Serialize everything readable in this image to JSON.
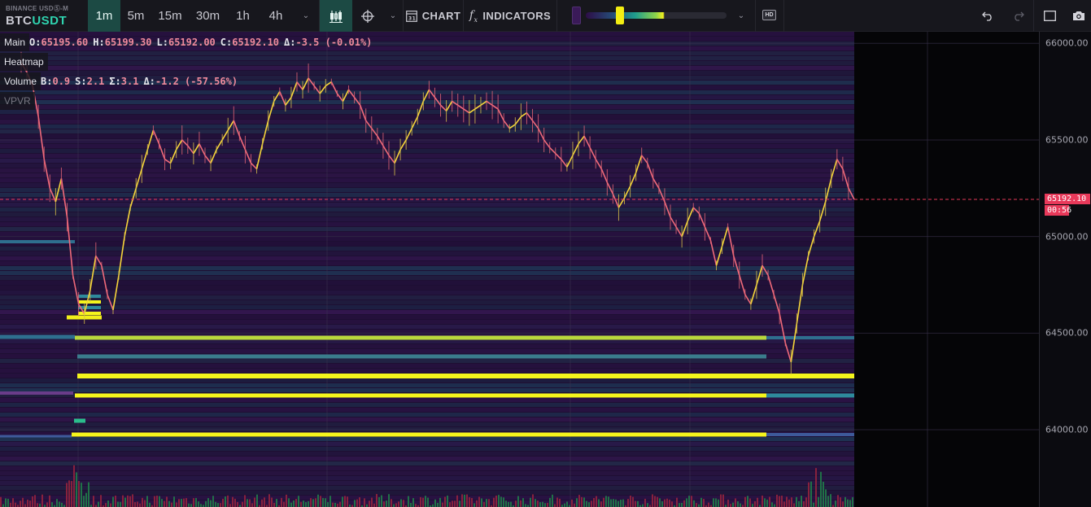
{
  "toolbar": {
    "exchange": "BINANCE USDⓈ-M",
    "symbol_base": "BTC",
    "symbol_quote": "USDT",
    "timeframes": [
      {
        "label": "1m",
        "active": true
      },
      {
        "label": "5m",
        "active": false
      },
      {
        "label": "15m",
        "active": false
      },
      {
        "label": "30m",
        "active": false
      },
      {
        "label": "1h",
        "active": false
      },
      {
        "label": "4h",
        "active": false
      }
    ],
    "chart_label": "CHART",
    "indicators_label": "INDICATORS",
    "hd_label": "HD",
    "colors": {
      "active_bg": "#1c4a44",
      "quote_color": "#2fd4b0"
    }
  },
  "legend": {
    "main": {
      "name": "Main",
      "fields": [
        {
          "k": "O:",
          "v": "65195.60"
        },
        {
          "k": "H:",
          "v": "65199.30"
        },
        {
          "k": "L:",
          "v": "65192.00"
        },
        {
          "k": "C:",
          "v": "65192.10"
        },
        {
          "k": "Δ:",
          "v": "-3.5 (-0.01%)"
        }
      ]
    },
    "heatmap": {
      "name": "Heatmap"
    },
    "volume": {
      "name": "Volume",
      "fields": [
        {
          "k": "B:",
          "v": "0.9"
        },
        {
          "k": "S:",
          "v": "2.1"
        },
        {
          "k": "Σ:",
          "v": "3.1"
        },
        {
          "k": "Δ:",
          "v": "-1.2 (-57.56%)"
        }
      ]
    },
    "vpvr": {
      "name": "VPVR"
    }
  },
  "price_axis": {
    "ticks": [
      "66000.00",
      "65500.00",
      "65000.00",
      "64500.00",
      "64000.00"
    ],
    "current_price": "65192.10",
    "countdown": "00:56",
    "current_color": "#e8395a"
  },
  "chart_data": {
    "type": "line",
    "title": "",
    "ylim": [
      63600,
      66060
    ],
    "current_price": 65192.1,
    "close_series": [
      65900,
      65850,
      65780,
      65620,
      65400,
      65250,
      65180,
      65300,
      65100,
      64800,
      64650,
      64600,
      64720,
      64900,
      64850,
      64700,
      64620,
      64800,
      65000,
      65150,
      65250,
      65350,
      65450,
      65550,
      65480,
      65400,
      65380,
      65450,
      65500,
      65470,
      65430,
      65480,
      65420,
      65380,
      65450,
      65500,
      65550,
      65600,
      65520,
      65450,
      65380,
      65350,
      65480,
      65600,
      65700,
      65750,
      65680,
      65720,
      65800,
      65760,
      65820,
      65780,
      65740,
      65780,
      65800,
      65740,
      65700,
      65760,
      65720,
      65680,
      65600,
      65560,
      65520,
      65470,
      65420,
      65380,
      65450,
      65500,
      65560,
      65620,
      65700,
      65760,
      65720,
      65680,
      65650,
      65700,
      65680,
      65660,
      65640,
      65660,
      65680,
      65700,
      65680,
      65660,
      65600,
      65560,
      65580,
      65620,
      65640,
      65600,
      65560,
      65500,
      65460,
      65430,
      65400,
      65360,
      65420,
      65480,
      65520,
      65460,
      65400,
      65350,
      65280,
      65220,
      65150,
      65200,
      65260,
      65330,
      65420,
      65380,
      65300,
      65250,
      65180,
      65100,
      65050,
      65000,
      65080,
      65150,
      65120,
      65050,
      64980,
      64850,
      64950,
      65050,
      64900,
      64800,
      64700,
      64650,
      64750,
      64850,
      64800,
      64700,
      64600,
      64450,
      64350,
      64550,
      64750,
      64900,
      65000,
      65080,
      65180,
      65300,
      65400,
      65350,
      65250,
      65192
    ]
  }
}
